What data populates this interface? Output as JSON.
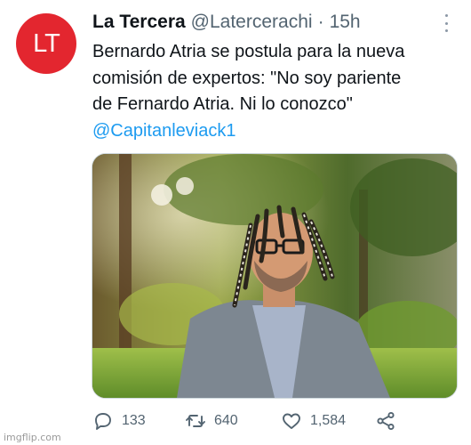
{
  "tweet": {
    "avatar_text": "LT",
    "display_name": "La Tercera",
    "handle": "@Latercerachi",
    "separator": "·",
    "time": "15h",
    "text_lines": [
      "Bernardo Atria se postula para la nueva",
      "comisión de expertos: \"No soy pariente",
      "de Fernardo Atria. Ni lo conozco\""
    ],
    "mention": "@Capitanleviack1"
  },
  "actions": {
    "reply_count": "133",
    "retweet_count": "640",
    "like_count": "1,584"
  },
  "icons": [
    "more-icon",
    "reply-icon",
    "retweet-icon",
    "like-icon",
    "share-icon"
  ],
  "colors": {
    "avatar_bg": "#e3262f",
    "link": "#1d9bf0",
    "secondary_text": "#536471"
  },
  "watermark": "imgflip.com"
}
